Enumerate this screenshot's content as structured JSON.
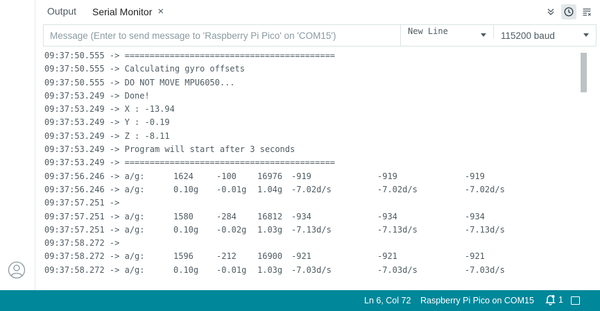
{
  "tabs": {
    "output_label": "Output",
    "serial_label": "Serial Monitor",
    "close_glyph": "×"
  },
  "toolbar": {
    "message_placeholder": "Message (Enter to send message to 'Raspberry Pi Pico' on 'COM15')",
    "line_ending": "New Line",
    "baud_rate": "115200 baud"
  },
  "console": {
    "lines": [
      {
        "ts": "09:37:50.555",
        "text": "=========================================="
      },
      {
        "ts": "09:37:50.555",
        "text": "Calculating gyro offsets"
      },
      {
        "ts": "09:37:50.555",
        "text": "DO NOT MOVE MPU6050..."
      },
      {
        "ts": "09:37:53.249",
        "text": "Done!"
      },
      {
        "ts": "09:37:53.249",
        "text": "X : -13.94"
      },
      {
        "ts": "09:37:53.249",
        "text": "Y : -0.19"
      },
      {
        "ts": "09:37:53.249",
        "text": "Z : -8.11"
      },
      {
        "ts": "09:37:53.249",
        "text": "Program will start after 3 seconds"
      },
      {
        "ts": "09:37:53.249",
        "text": "=========================================="
      },
      {
        "ts": "09:37:56.246",
        "text": "a/g:",
        "c1": "1624",
        "c2": "-100",
        "c3": "16976",
        "c4": "-919",
        "c5": "-919",
        "c6": "-919"
      },
      {
        "ts": "09:37:56.246",
        "text": "a/g:",
        "c1": "0.10g",
        "c2": "-0.01g",
        "c3": "1.04g",
        "c4": "-7.02d/s",
        "c5": "-7.02d/s",
        "c6": "-7.02d/s"
      },
      {
        "ts": "09:37:57.251",
        "text": ""
      },
      {
        "ts": "09:37:57.251",
        "text": "a/g:",
        "c1": "1580",
        "c2": "-284",
        "c3": "16812",
        "c4": "-934",
        "c5": "-934",
        "c6": "-934"
      },
      {
        "ts": "09:37:57.251",
        "text": "a/g:",
        "c1": "0.10g",
        "c2": "-0.02g",
        "c3": "1.03g",
        "c4": "-7.13d/s",
        "c5": "-7.13d/s",
        "c6": "-7.13d/s"
      },
      {
        "ts": "09:37:58.272",
        "text": ""
      },
      {
        "ts": "09:37:58.272",
        "text": "a/g:",
        "c1": "1596",
        "c2": "-212",
        "c3": "16900",
        "c4": "-921",
        "c5": "-921",
        "c6": "-921"
      },
      {
        "ts": "09:37:58.272",
        "text": "a/g:",
        "c1": "0.10g",
        "c2": "-0.01g",
        "c3": "1.03g",
        "c4": "-7.03d/s",
        "c5": "-7.03d/s",
        "c6": "-7.03d/s"
      }
    ]
  },
  "status_bar": {
    "cursor_position": "Ln 6, Col 72",
    "board_port": "Raspberry Pi Pico on COM15",
    "notification_count": "1"
  },
  "icons": {
    "account": "account-icon",
    "chevrons": "double-chevron-down-icon",
    "timestamp": "clock-icon",
    "clear": "clear-output-icon",
    "notification": "bell-icon",
    "panel_toggle": "panel-toggle-icon"
  },
  "colors": {
    "status_bar_bg": "#00879a",
    "text": "#4e5b61"
  }
}
